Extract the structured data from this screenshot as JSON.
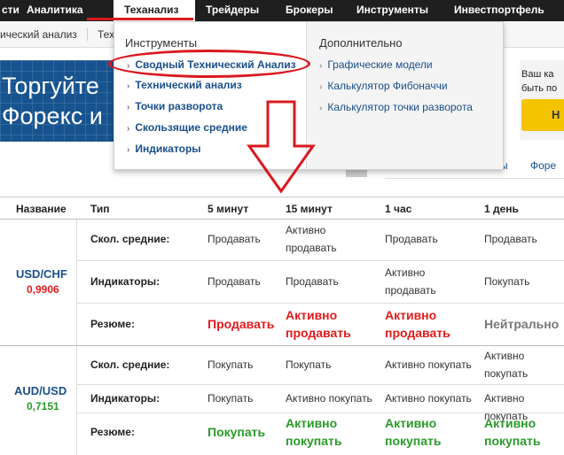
{
  "colors": {
    "nav_bg": "#1f1f1f",
    "link": "#1a4f8a",
    "sell": "#e01b1b",
    "buy": "#2a9a2a",
    "neutral": "#777777",
    "highlight": "#d9191f"
  },
  "nav": {
    "items": [
      {
        "label": "сти"
      },
      {
        "label": "Аналитика"
      },
      {
        "label": "Теханализ"
      },
      {
        "label": "Трейдеры"
      },
      {
        "label": "Брокеры"
      },
      {
        "label": "Инструменты"
      },
      {
        "label": "Инвестпортфель"
      }
    ]
  },
  "subnav": {
    "items": [
      {
        "label": "ический анализ"
      },
      {
        "label": "Тех"
      }
    ]
  },
  "banner": {
    "line1": "Торгуйте",
    "line2": "Форекс и"
  },
  "right_promo": {
    "line1": "Ваш ка",
    "line2": "быть по",
    "button_label": "Н"
  },
  "mid_tabs": {
    "tab1": "ы",
    "tab2": "Форе"
  },
  "dropdown": {
    "left_heading": "Инструменты",
    "left_links": [
      {
        "label": "Сводный Технический Анализ"
      },
      {
        "label": "Технический анализ"
      },
      {
        "label": "Точки разворота"
      },
      {
        "label": "Скользящие средние"
      },
      {
        "label": "Индикаторы"
      }
    ],
    "right_heading": "Дополнительно",
    "right_links": [
      {
        "label": "Графические модели"
      },
      {
        "label": "Калькулятор Фибоначчи"
      },
      {
        "label": "Калькулятор точки разворота"
      }
    ]
  },
  "table": {
    "headers": {
      "name": "Название",
      "type": "Тип",
      "m5": "5 минут",
      "m15": "15 минут",
      "h1": "1 час",
      "d1": "1 день"
    },
    "pairs": [
      {
        "name": "USD/CHF",
        "price": "0,9906",
        "price_dir": "down",
        "rows": [
          {
            "label": "Скол. средние:",
            "m5": "Продавать",
            "m15": "Активно продавать",
            "h1": "Продавать",
            "d1": "Продавать"
          },
          {
            "label": "Индикаторы:",
            "m5": "Продавать",
            "m15": "Продавать",
            "h1": "Активно продавать",
            "d1": "Покупать"
          }
        ],
        "summary": {
          "label": "Резюме:",
          "m5": "Продавать",
          "m15": "Активно продавать",
          "h1": "Активно продавать",
          "d1": "Нейтрально"
        }
      },
      {
        "name": "AUD/USD",
        "price": "0,7151",
        "price_dir": "up",
        "rows": [
          {
            "label": "Скол. средние:",
            "m5": "Покупать",
            "m15": "Покупать",
            "h1": "Активно покупать",
            "d1": "Активно покупать"
          },
          {
            "label": "Индикаторы:",
            "m5": "Покупать",
            "m15": "Активно покупать",
            "h1": "Активно покупать",
            "d1": "Активно покупать"
          }
        ],
        "summary": {
          "label": "Резюме:",
          "m5": "Покупать",
          "m15": "Активно покупать",
          "h1": "Активно покупать",
          "d1": "Активно покупать"
        }
      }
    ]
  }
}
